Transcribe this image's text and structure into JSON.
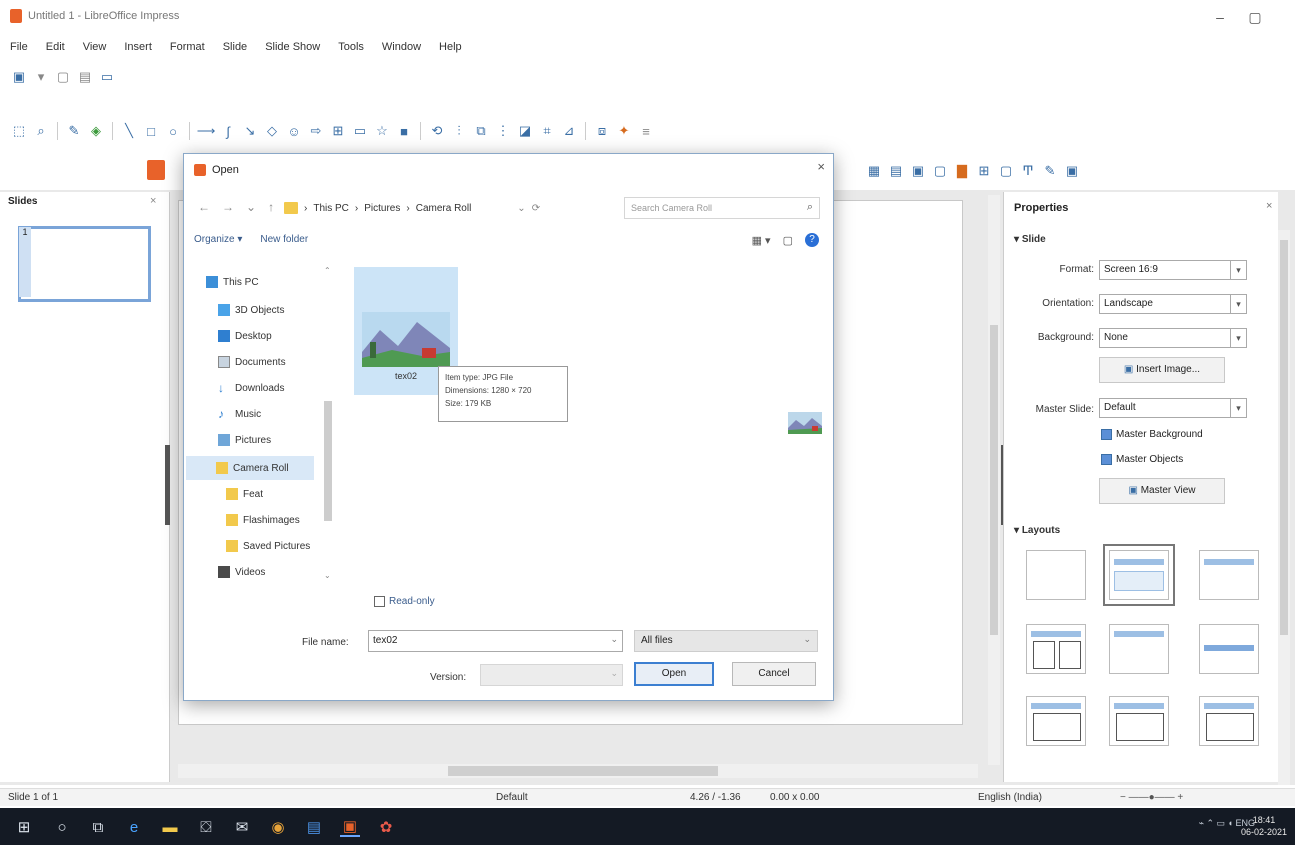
{
  "window": {
    "title": "Untitled 1 - LibreOffice Impress",
    "minimize": "–",
    "maximize": "▢"
  },
  "menu": [
    "File",
    "Edit",
    "View",
    "Insert",
    "Format",
    "Slide",
    "Slide Show",
    "Tools",
    "Window",
    "Help"
  ],
  "slides_pane": {
    "title": "Slides",
    "slide_number": "1"
  },
  "dialog": {
    "title": "Open",
    "breadcrumb": [
      "This PC",
      "Pictures",
      "Camera Roll"
    ],
    "search_placeholder": "Search Camera Roll",
    "organize": "Organize ▾",
    "new_folder": "New folder",
    "tree": [
      {
        "label": "This PC",
        "icon": "pc-icon"
      },
      {
        "label": "3D Objects",
        "icon": "cube-icon"
      },
      {
        "label": "Desktop",
        "icon": "desktop-icon"
      },
      {
        "label": "Documents",
        "icon": "documents-icon"
      },
      {
        "label": "Downloads",
        "icon": "download-icon"
      },
      {
        "label": "Music",
        "icon": "music-icon"
      },
      {
        "label": "Pictures",
        "icon": "pictures-icon"
      },
      {
        "label": "Camera Roll",
        "icon": "folder-icon"
      },
      {
        "label": "Feat",
        "icon": "folder-icon"
      },
      {
        "label": "Flashimages",
        "icon": "folder-icon"
      },
      {
        "label": "Saved Pictures",
        "icon": "folder-icon"
      },
      {
        "label": "Videos",
        "icon": "video-icon"
      }
    ],
    "file": {
      "name": "tex02"
    },
    "tooltip": {
      "line1": "Item type: JPG File",
      "line2": "Dimensions: 1280 × 720",
      "line3": "Size: 179 KB"
    },
    "read_only": "Read-only",
    "file_name_label": "File name:",
    "file_name_value": "tex02",
    "filter": "All files",
    "version_label": "Version:",
    "open": "Open",
    "cancel": "Cancel"
  },
  "properties": {
    "title": "Properties",
    "slide_section": "Slide",
    "format_label": "Format:",
    "format_value": "Screen 16:9",
    "orientation_label": "Orientation:",
    "orientation_value": "Landscape",
    "background_label": "Background:",
    "background_value": "None",
    "insert_image": "Insert Image...",
    "master_slide_label": "Master Slide:",
    "master_slide_value": "Default",
    "master_background": "Master Background",
    "master_objects": "Master Objects",
    "master_view": "Master View",
    "layouts_section": "Layouts"
  },
  "statusbar": {
    "slide": "Slide 1 of 1",
    "master": "Default",
    "position": "4.26 / -1.36",
    "size": "0.00 x 0.00",
    "language": "English (India)"
  },
  "taskbar": {
    "tray": "ENG",
    "time": "18:41",
    "date": "06-02-2021"
  },
  "colors": {
    "accent": "#3c7fd1",
    "taskbar": "#141a24",
    "selection": "#cce4f7"
  }
}
